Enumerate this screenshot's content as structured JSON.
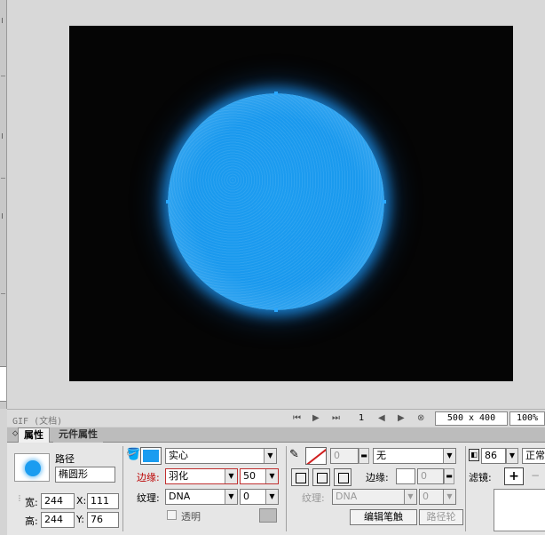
{
  "status": {
    "doc_label": "GIF (文档)",
    "frame": "1",
    "doc_size": "500 x 400",
    "zoom": "100%"
  },
  "tabs": [
    "属性",
    "元件属性"
  ],
  "object": {
    "type": "路径",
    "name": "椭圆形",
    "width_label": "宽:",
    "width": "244",
    "height_label": "高:",
    "height": "244",
    "x_label": "X:",
    "x": "111",
    "y_label": "Y:",
    "y": "76"
  },
  "fill": {
    "color": "#1a9cf0",
    "type": "实心",
    "edge_label": "边缘:",
    "edge": "羽化",
    "edge_amount": "50",
    "texture_label": "纹理:",
    "texture": "DNA",
    "texture_amount": "0",
    "transparent_label": "透明"
  },
  "stroke": {
    "amount": "0",
    "type": "无",
    "edge_label": "边缘:",
    "edge_value": "0",
    "texture_label": "纹理:",
    "texture": "DNA",
    "texture_amount": "0",
    "edit_button": "编辑笔触",
    "path_button": "路径轮"
  },
  "opacity": "86",
  "blend": "正常",
  "filters_label": "滤镜:",
  "colors": {
    "canvas_bg": "#050505",
    "circle": "#1a9cf0"
  }
}
